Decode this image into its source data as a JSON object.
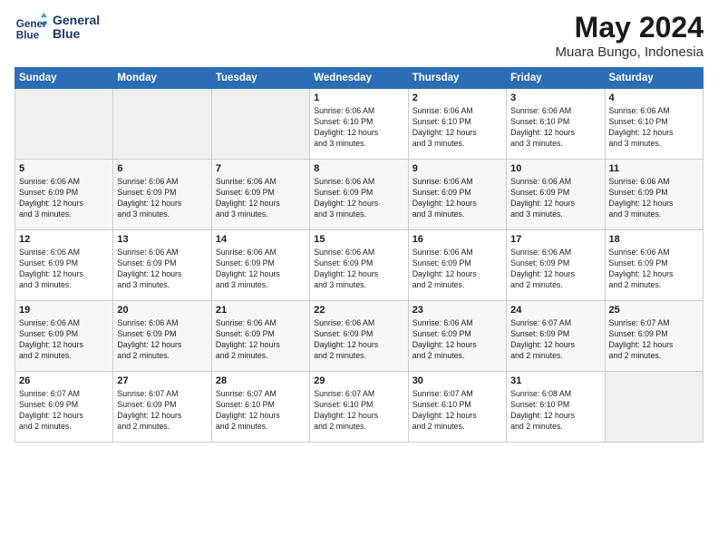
{
  "header": {
    "logo_line1": "General",
    "logo_line2": "Blue",
    "month_title": "May 2024",
    "location": "Muara Bungo, Indonesia"
  },
  "weekdays": [
    "Sunday",
    "Monday",
    "Tuesday",
    "Wednesday",
    "Thursday",
    "Friday",
    "Saturday"
  ],
  "weeks": [
    [
      {
        "day": "",
        "info": ""
      },
      {
        "day": "",
        "info": ""
      },
      {
        "day": "",
        "info": ""
      },
      {
        "day": "1",
        "info": "Sunrise: 6:06 AM\nSunset: 6:10 PM\nDaylight: 12 hours\nand 3 minutes."
      },
      {
        "day": "2",
        "info": "Sunrise: 6:06 AM\nSunset: 6:10 PM\nDaylight: 12 hours\nand 3 minutes."
      },
      {
        "day": "3",
        "info": "Sunrise: 6:06 AM\nSunset: 6:10 PM\nDaylight: 12 hours\nand 3 minutes."
      },
      {
        "day": "4",
        "info": "Sunrise: 6:06 AM\nSunset: 6:10 PM\nDaylight: 12 hours\nand 3 minutes."
      }
    ],
    [
      {
        "day": "5",
        "info": "Sunrise: 6:06 AM\nSunset: 6:09 PM\nDaylight: 12 hours\nand 3 minutes."
      },
      {
        "day": "6",
        "info": "Sunrise: 6:06 AM\nSunset: 6:09 PM\nDaylight: 12 hours\nand 3 minutes."
      },
      {
        "day": "7",
        "info": "Sunrise: 6:06 AM\nSunset: 6:09 PM\nDaylight: 12 hours\nand 3 minutes."
      },
      {
        "day": "8",
        "info": "Sunrise: 6:06 AM\nSunset: 6:09 PM\nDaylight: 12 hours\nand 3 minutes."
      },
      {
        "day": "9",
        "info": "Sunrise: 6:06 AM\nSunset: 6:09 PM\nDaylight: 12 hours\nand 3 minutes."
      },
      {
        "day": "10",
        "info": "Sunrise: 6:06 AM\nSunset: 6:09 PM\nDaylight: 12 hours\nand 3 minutes."
      },
      {
        "day": "11",
        "info": "Sunrise: 6:06 AM\nSunset: 6:09 PM\nDaylight: 12 hours\nand 3 minutes."
      }
    ],
    [
      {
        "day": "12",
        "info": "Sunrise: 6:06 AM\nSunset: 6:09 PM\nDaylight: 12 hours\nand 3 minutes."
      },
      {
        "day": "13",
        "info": "Sunrise: 6:06 AM\nSunset: 6:09 PM\nDaylight: 12 hours\nand 3 minutes."
      },
      {
        "day": "14",
        "info": "Sunrise: 6:06 AM\nSunset: 6:09 PM\nDaylight: 12 hours\nand 3 minutes."
      },
      {
        "day": "15",
        "info": "Sunrise: 6:06 AM\nSunset: 6:09 PM\nDaylight: 12 hours\nand 3 minutes."
      },
      {
        "day": "16",
        "info": "Sunrise: 6:06 AM\nSunset: 6:09 PM\nDaylight: 12 hours\nand 2 minutes."
      },
      {
        "day": "17",
        "info": "Sunrise: 6:06 AM\nSunset: 6:09 PM\nDaylight: 12 hours\nand 2 minutes."
      },
      {
        "day": "18",
        "info": "Sunrise: 6:06 AM\nSunset: 6:09 PM\nDaylight: 12 hours\nand 2 minutes."
      }
    ],
    [
      {
        "day": "19",
        "info": "Sunrise: 6:06 AM\nSunset: 6:09 PM\nDaylight: 12 hours\nand 2 minutes."
      },
      {
        "day": "20",
        "info": "Sunrise: 6:06 AM\nSunset: 6:09 PM\nDaylight: 12 hours\nand 2 minutes."
      },
      {
        "day": "21",
        "info": "Sunrise: 6:06 AM\nSunset: 6:09 PM\nDaylight: 12 hours\nand 2 minutes."
      },
      {
        "day": "22",
        "info": "Sunrise: 6:06 AM\nSunset: 6:09 PM\nDaylight: 12 hours\nand 2 minutes."
      },
      {
        "day": "23",
        "info": "Sunrise: 6:06 AM\nSunset: 6:09 PM\nDaylight: 12 hours\nand 2 minutes."
      },
      {
        "day": "24",
        "info": "Sunrise: 6:07 AM\nSunset: 6:09 PM\nDaylight: 12 hours\nand 2 minutes."
      },
      {
        "day": "25",
        "info": "Sunrise: 6:07 AM\nSunset: 6:09 PM\nDaylight: 12 hours\nand 2 minutes."
      }
    ],
    [
      {
        "day": "26",
        "info": "Sunrise: 6:07 AM\nSunset: 6:09 PM\nDaylight: 12 hours\nand 2 minutes."
      },
      {
        "day": "27",
        "info": "Sunrise: 6:07 AM\nSunset: 6:09 PM\nDaylight: 12 hours\nand 2 minutes."
      },
      {
        "day": "28",
        "info": "Sunrise: 6:07 AM\nSunset: 6:10 PM\nDaylight: 12 hours\nand 2 minutes."
      },
      {
        "day": "29",
        "info": "Sunrise: 6:07 AM\nSunset: 6:10 PM\nDaylight: 12 hours\nand 2 minutes."
      },
      {
        "day": "30",
        "info": "Sunrise: 6:07 AM\nSunset: 6:10 PM\nDaylight: 12 hours\nand 2 minutes."
      },
      {
        "day": "31",
        "info": "Sunrise: 6:08 AM\nSunset: 6:10 PM\nDaylight: 12 hours\nand 2 minutes."
      },
      {
        "day": "",
        "info": ""
      }
    ]
  ]
}
